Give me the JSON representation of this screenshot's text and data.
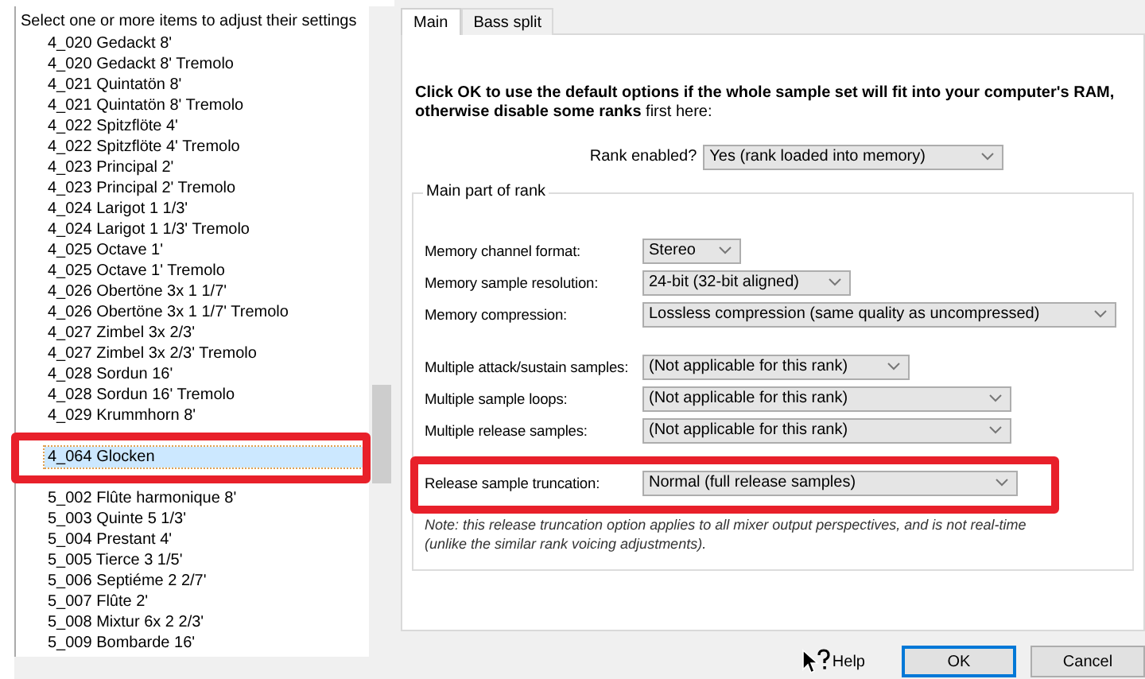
{
  "list": {
    "header": "Select one or more items to adjust their settings",
    "items": [
      {
        "label": "4_020 Gedackt 8'",
        "selected": false
      },
      {
        "label": "4_020 Gedackt 8' Tremolo",
        "selected": false
      },
      {
        "label": "4_021 Quintatön 8'",
        "selected": false
      },
      {
        "label": "4_021 Quintatön 8' Tremolo",
        "selected": false
      },
      {
        "label": "4_022 Spitzflöte 4'",
        "selected": false
      },
      {
        "label": "4_022 Spitzflöte 4' Tremolo",
        "selected": false
      },
      {
        "label": "4_023 Principal 2'",
        "selected": false
      },
      {
        "label": "4_023 Principal 2' Tremolo",
        "selected": false
      },
      {
        "label": "4_024 Larigot 1 1/3'",
        "selected": false
      },
      {
        "label": "4_024 Larigot 1 1/3' Tremolo",
        "selected": false
      },
      {
        "label": "4_025 Octave 1'",
        "selected": false
      },
      {
        "label": "4_025 Octave 1' Tremolo",
        "selected": false
      },
      {
        "label": "4_026 Obertöne 3x 1 1/7'",
        "selected": false
      },
      {
        "label": "4_026 Obertöne 3x 1 1/7' Tremolo",
        "selected": false
      },
      {
        "label": "4_027 Zimbel 3x 2/3'",
        "selected": false
      },
      {
        "label": "4_027 Zimbel 3x 2/3' Tremolo",
        "selected": false
      },
      {
        "label": "4_028 Sordun 16'",
        "selected": false
      },
      {
        "label": "4_028 Sordun 16' Tremolo",
        "selected": false
      },
      {
        "label": "4_029 Krummhorn 8'",
        "selected": false
      },
      {
        "label": "4_064 Glocken",
        "selected": true
      },
      {
        "label": "5_002 Flûte harmonique 8'",
        "selected": false
      },
      {
        "label": "5_003 Quinte 5 1/3'",
        "selected": false
      },
      {
        "label": "5_004 Prestant 4'",
        "selected": false
      },
      {
        "label": "5_005 Tierce 3 1/5'",
        "selected": false
      },
      {
        "label": "5_006 Septiéme 2 2/7'",
        "selected": false
      },
      {
        "label": "5_007 Flûte 2'",
        "selected": false
      },
      {
        "label": "5_008 Mixtur 6x 2 2/3'",
        "selected": false
      },
      {
        "label": "5_009 Bombarde 16'",
        "selected": false
      }
    ]
  },
  "tabs": [
    {
      "label": "Main",
      "selected": true
    },
    {
      "label": "Bass split",
      "selected": false
    }
  ],
  "intro": "**Click OK to use the default options if the whole sample set will fit into your computer's RAM, otherwise disable some ranks** first here:",
  "rank_enabled": {
    "label": "Rank enabled?",
    "value": "Yes (rank loaded into memory)"
  },
  "group": {
    "title": "Main part of rank",
    "sections": [
      [
        {
          "label": "Memory channel format:",
          "value": "Stereo"
        },
        {
          "label": "Memory sample resolution:",
          "value": "24-bit (32-bit aligned)"
        },
        {
          "label": "Memory compression:",
          "value": "Lossless compression (same quality as uncompressed)"
        }
      ],
      [
        {
          "label": "Multiple attack/sustain samples:",
          "value": "(Not applicable for this rank)"
        },
        {
          "label": "Multiple sample loops:",
          "value": "(Not applicable for this rank)"
        },
        {
          "label": "Multiple release samples:",
          "value": "(Not applicable for this rank)"
        }
      ],
      [
        {
          "label": "Release sample truncation:",
          "value": "Normal (full release samples)"
        }
      ]
    ],
    "note": "Note: this release truncation option applies to all mixer output perspectives, and is not real-time (unlike the similar rank voicing adjustments)."
  },
  "buttons": [
    {
      "kind": "help",
      "label": "Help"
    },
    {
      "kind": "default",
      "label": "OK"
    },
    {
      "kind": "plain",
      "label": "Cancel"
    }
  ]
}
